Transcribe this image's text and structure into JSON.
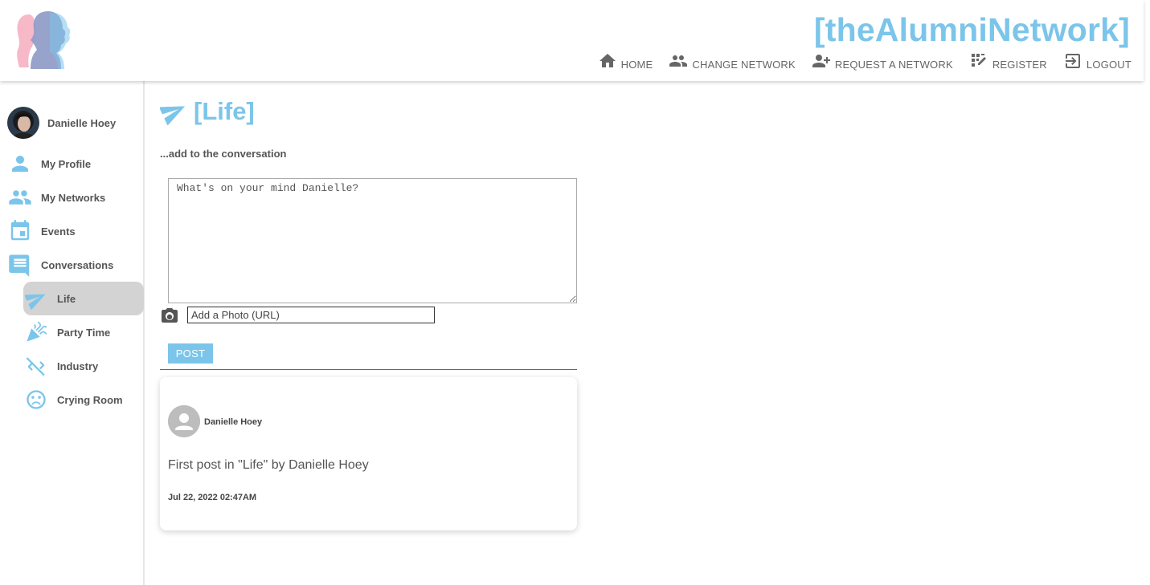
{
  "brand": "[theAlumniNetwork]",
  "nav": [
    {
      "label": "HOME",
      "icon": "home-icon"
    },
    {
      "label": "CHANGE NETWORK",
      "icon": "people-icon"
    },
    {
      "label": "REQUEST A NETWORK",
      "icon": "person-add-icon"
    },
    {
      "label": "REGISTER",
      "icon": "register-icon"
    },
    {
      "label": "LOGOUT",
      "icon": "logout-icon"
    }
  ],
  "sidebar": {
    "user_name": "Danielle Hoey",
    "items": [
      {
        "label": "My Profile",
        "icon": "person-icon"
      },
      {
        "label": "My Networks",
        "icon": "people-icon"
      },
      {
        "label": "Events",
        "icon": "calendar-icon"
      },
      {
        "label": "Conversations",
        "icon": "chat-icon"
      }
    ],
    "sub_items": [
      {
        "label": "Life",
        "icon": "send-icon",
        "active": true
      },
      {
        "label": "Party Time",
        "icon": "celebration-icon",
        "active": false
      },
      {
        "label": "Industry",
        "icon": "no-tools-icon",
        "active": false
      },
      {
        "label": "Crying Room",
        "icon": "sad-face-icon",
        "active": false
      }
    ]
  },
  "main": {
    "title": "[Life]",
    "subtitle": "...add to the conversation",
    "textarea_placeholder": "What's on your mind Danielle?",
    "photo_placeholder": "Add a Photo (URL)",
    "post_label": "POST"
  },
  "posts": [
    {
      "author": "Danielle Hoey",
      "text": "First post in \"Life\" by Danielle Hoey",
      "date": "Jul 22, 2022 02:47AM"
    }
  ],
  "colors": {
    "accent": "#7cc5ea",
    "active_bg": "#d3d3d3",
    "text": "#555555"
  }
}
